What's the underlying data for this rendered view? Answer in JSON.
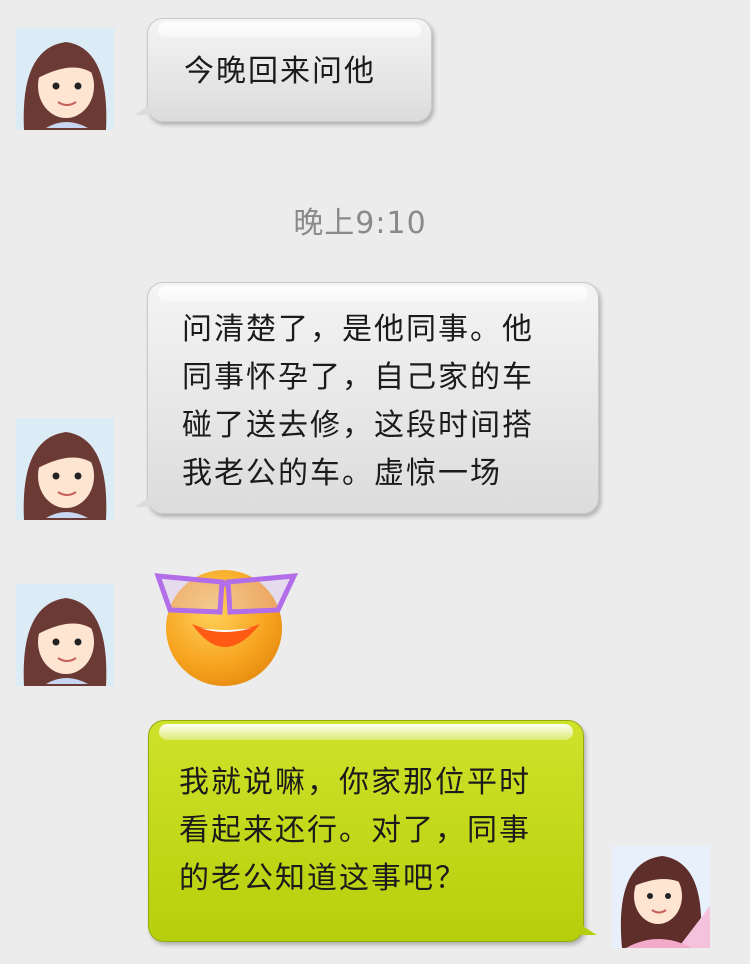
{
  "messages": [
    {
      "sender": "other",
      "text": "今晚回来问他"
    },
    {
      "sender": "other",
      "text": "问清楚了，是他同事。他\n同事怀孕了，自己家的车\n碰了送去修，这段时间搭\n我老公的车。虚惊一场"
    },
    {
      "sender": "other",
      "type": "emoji",
      "icon": "laughing-face-sunglasses-icon"
    },
    {
      "sender": "me",
      "text": "我就说嘛，你家那位平时\n看起来还行。对了，同事\n的老公知道这事吧？"
    }
  ],
  "timestamp": "晚上9:10",
  "colors": {
    "background": "#ececec",
    "bubble_gray": "#e4e4e4",
    "bubble_green": "#c2d81a",
    "timestamp": "#8a8a8a"
  }
}
